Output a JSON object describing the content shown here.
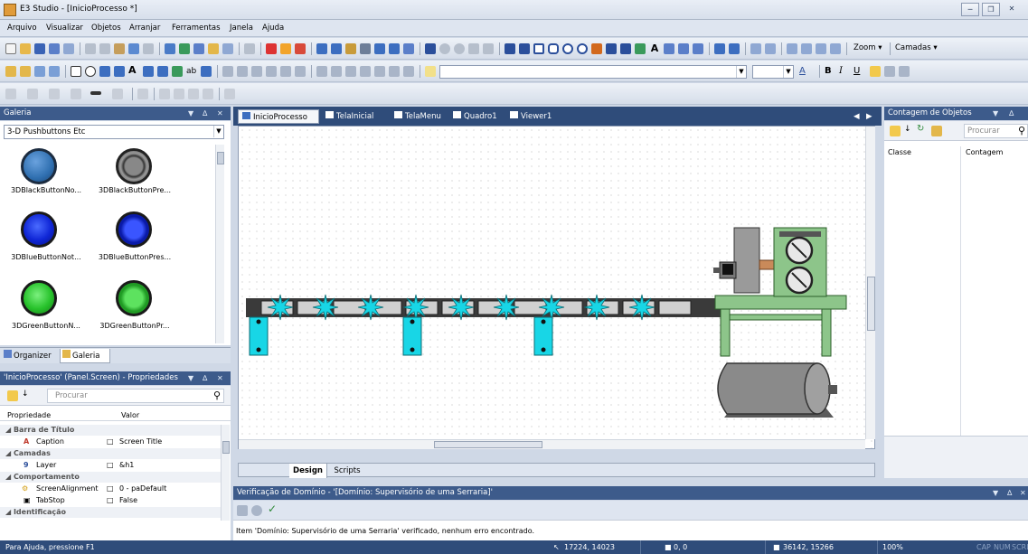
{
  "window": {
    "title": "E3 Studio - [InicioProcesso *]"
  },
  "menu": [
    "Arquivo",
    "Visualizar",
    "Objetos",
    "Arranjar",
    "Ferramentas",
    "Janela",
    "Ajuda"
  ],
  "toolbar": {
    "zoom_label": "Zoom",
    "layers_label": "Camadas"
  },
  "galeria": {
    "title": "Galeria",
    "category": "3-D Pushbuttons Etc",
    "items": [
      {
        "label": "3DBlackButtonNo...",
        "color": "#2f6fb0"
      },
      {
        "label": "3DBlackButtonPre...",
        "color": "#7a7a7a"
      },
      {
        "label": "3DBlueButtonNot...",
        "color": "#1230e0"
      },
      {
        "label": "3DBlueButtonPres...",
        "color": "#1a36ff"
      },
      {
        "label": "3DGreenButtonN...",
        "color": "#27c22b"
      },
      {
        "label": "3DGreenButtonPr...",
        "color": "#3ad83e"
      }
    ],
    "tabs": [
      "Organizer",
      "Galeria"
    ]
  },
  "properties": {
    "title": "'InicioProcesso' (Panel.Screen) - Propriedades",
    "search_placeholder": "Procurar",
    "col_property": "Propriedade",
    "col_value": "Valor",
    "rows": [
      {
        "type": "cat",
        "name": "Barra de Título"
      },
      {
        "type": "prop",
        "name": "Caption",
        "value": "Screen Title"
      },
      {
        "type": "cat",
        "name": "Camadas"
      },
      {
        "type": "prop",
        "name": "Layer",
        "value": "&h1"
      },
      {
        "type": "cat",
        "name": "Comportamento"
      },
      {
        "type": "prop",
        "name": "ScreenAlignment",
        "value": "0 - paDefault"
      },
      {
        "type": "prop",
        "name": "TabStop",
        "value": "False"
      },
      {
        "type": "cat",
        "name": "Identificação"
      }
    ]
  },
  "document_tabs": [
    {
      "label": "InicioProcesso *",
      "active": true
    },
    {
      "label": "TelaInicial",
      "active": false
    },
    {
      "label": "TelaMenu",
      "active": false
    },
    {
      "label": "Quadro1",
      "active": false
    },
    {
      "label": "Viewer1",
      "active": false
    }
  ],
  "bottom_tabs": [
    "Design",
    "Scripts"
  ],
  "counter": {
    "title": "Contagem de Objetos",
    "search_placeholder": "Procurar",
    "col_class": "Classe",
    "col_count": "Contagem"
  },
  "verification": {
    "title": "Verificação de Domínio - '[Domínio: Supervisório de uma Serraria]'",
    "message": "Item 'Domínio: Supervisório de uma Serraria' verificado, nenhum erro encontrado."
  },
  "status": {
    "help": "Para Ajuda, pressione F1",
    "coords": "17224, 14023",
    "offset": "0, 0",
    "size": "36142, 15266",
    "zoom": "100%",
    "indicators": [
      "CAP",
      "NUM",
      "SCRL"
    ]
  }
}
